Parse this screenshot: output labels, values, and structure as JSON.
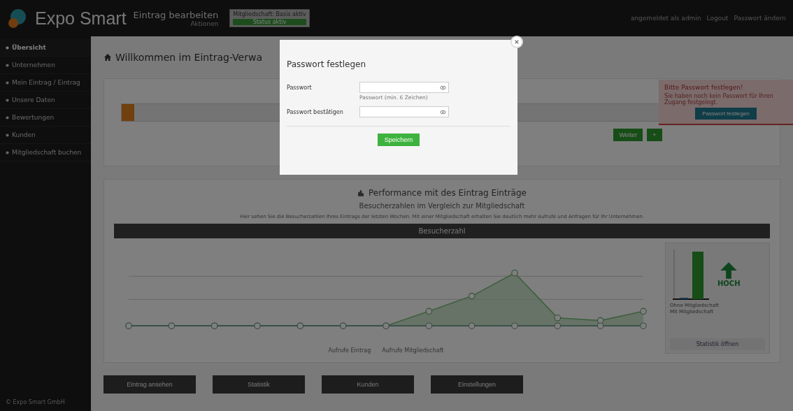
{
  "header": {
    "brand": "Expo Smart",
    "page_title": "Eintrag bearbeiten",
    "page_subtitle": "Aktionen",
    "status_box": {
      "text": "Mitgliedschaft: Basis aktiv",
      "badge": "Status aktiv"
    },
    "user_links": [
      "angemeldet als admin",
      "Logout",
      "Passwort ändern"
    ]
  },
  "sidebar": {
    "items": [
      {
        "label": "Übersicht",
        "selected": true
      },
      {
        "label": "Unternehmen",
        "selected": false
      },
      {
        "label": "Mein Eintrag / Eintrag",
        "selected": false
      },
      {
        "label": "Unsere Daten",
        "selected": false
      },
      {
        "label": "Bewertungen",
        "selected": false
      },
      {
        "label": "Kunden",
        "selected": false
      },
      {
        "label": "Mitgliedschaft buchen",
        "selected": false
      }
    ],
    "footer": "© Expo Smart GmbH"
  },
  "main": {
    "title": "Willkommen im Eintrag-Verwa",
    "progress": {
      "level": 0.02,
      "buttons": [
        "Weiter",
        "+"
      ]
    },
    "alert": {
      "title": "Bitte Passwort festlegen!",
      "text": "Sie haben noch kein Passwort für Ihren Zugang festgelegt.",
      "button": "Passwort festlegen"
    },
    "performance": {
      "title": "Performance mit des Eintrag Einträge",
      "subtitle": "Besucherzahlen im Vergleich zur Mitgliedschaft",
      "description": "Hier sehen Sie die Besucherzahlen Ihres Eintrags der letzten Wochen. Mit einer Mitgliedschaft erhalten Sie deutlich mehr Aufrufe und Anfragen für Ihr Unternehmen.",
      "chart_header": "Besucherzahl",
      "legend": [
        "Aufrufe Eintrag",
        "Aufrufe Mitgliedschaft"
      ],
      "trend": "HOCH",
      "side_legend": [
        "Ohne Mitgliedschaft",
        "Mit Mitgliedschaft"
      ],
      "side_footer": "Statistik öffnen"
    },
    "bottom_buttons": [
      "Eintrag ansehen",
      "Statistik",
      "Kunden",
      "Einstellungen"
    ]
  },
  "modal": {
    "title": "Passwort festlegen",
    "fields": [
      {
        "label": "Passwort",
        "help": "Passwort (min. 6 Zeichen)"
      },
      {
        "label": "Passwort bestätigen"
      }
    ],
    "button": "Speichern"
  }
}
